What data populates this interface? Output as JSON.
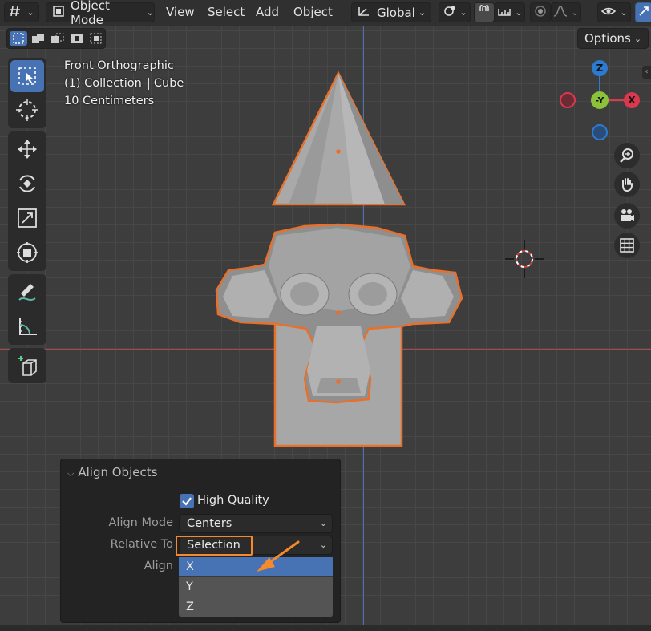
{
  "header": {
    "editor_type_icon": "grid-editor-icon",
    "mode_label": "Object Mode",
    "menus": [
      "View",
      "Select",
      "Add",
      "Object"
    ],
    "transform_orientation": "Global"
  },
  "options_label": "Options",
  "viewport": {
    "view_name": "Front Orthographic",
    "collection": "(1) Collection",
    "active_object": "Cube",
    "scale_text": "10 Centimeters"
  },
  "gizmo": {
    "z": "Z",
    "y": "-Y",
    "x": "X"
  },
  "toolbar": [
    "select-box-tool",
    "cursor-tool",
    "move-tool",
    "rotate-tool",
    "scale-tool",
    "transform-tool",
    "annotate-tool",
    "measure-tool",
    "add-cube-tool"
  ],
  "panel": {
    "title": "Align Objects",
    "high_quality_label": "High Quality",
    "high_quality_checked": true,
    "align_mode_label": "Align Mode",
    "align_mode_value": "Centers",
    "relative_to_label": "Relative To",
    "relative_to_value": "Selection",
    "align_label": "Align",
    "align_options": [
      "X",
      "Y",
      "Z"
    ],
    "align_selected": "X"
  },
  "colors": {
    "accent": "#4772b3",
    "highlight_box": "#f5892b",
    "selection_outline": "#e8702a",
    "x_axis": "#d9384f",
    "y_axis": "#8bc23a",
    "z_axis": "#2d7bd1"
  }
}
